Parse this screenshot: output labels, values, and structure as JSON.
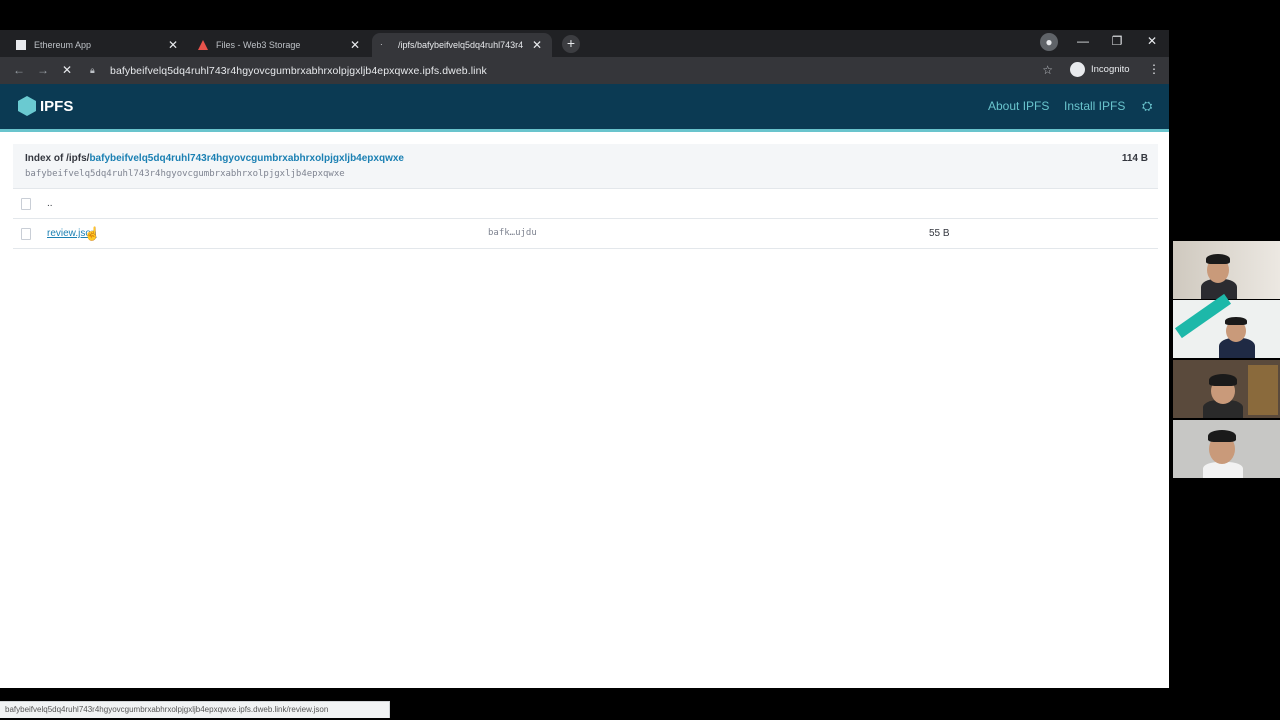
{
  "browser": {
    "tabs": [
      {
        "title": "Ethereum App",
        "active": false
      },
      {
        "title": "Files - Web3 Storage",
        "active": false
      },
      {
        "title": "/ipfs/bafybeifvelq5dq4ruhl743r4",
        "active": true
      }
    ],
    "url": "bafybeifvelq5dq4ruhl743r4hgyovcgumbrxabhrxolpjgxljb4epxqwxe.ipfs.dweb.link",
    "incognito_label": "Incognito"
  },
  "header": {
    "logo_text": "IPFS",
    "links": [
      "About IPFS",
      "Install IPFS"
    ]
  },
  "index": {
    "title_prefix": "Index of /ipfs/",
    "title_hash": "bafybeifvelq5dq4ruhl743r4hgyovcgumbrxabhrxolpjgxljb4epxqwxe",
    "hash_line": "bafybeifvelq5dq4ruhl743r4hgyovcgumbrxabhrxolpjgxljb4epxqwxe",
    "total_size": "114 B",
    "parent_row": "..",
    "files": [
      {
        "name": "review.json",
        "cid": "bafk…ujdu",
        "size": "55 B"
      }
    ]
  },
  "status_bar": "bafybeifvelq5dq4ruhl743r4hgyovcgumbrxabhrxolpjgxljb4epxqwxe.ipfs.dweb.link/review.json",
  "colors": {
    "header_bg": "#0b3a53",
    "accent": "#69c4cd",
    "link": "#1b80b3"
  }
}
